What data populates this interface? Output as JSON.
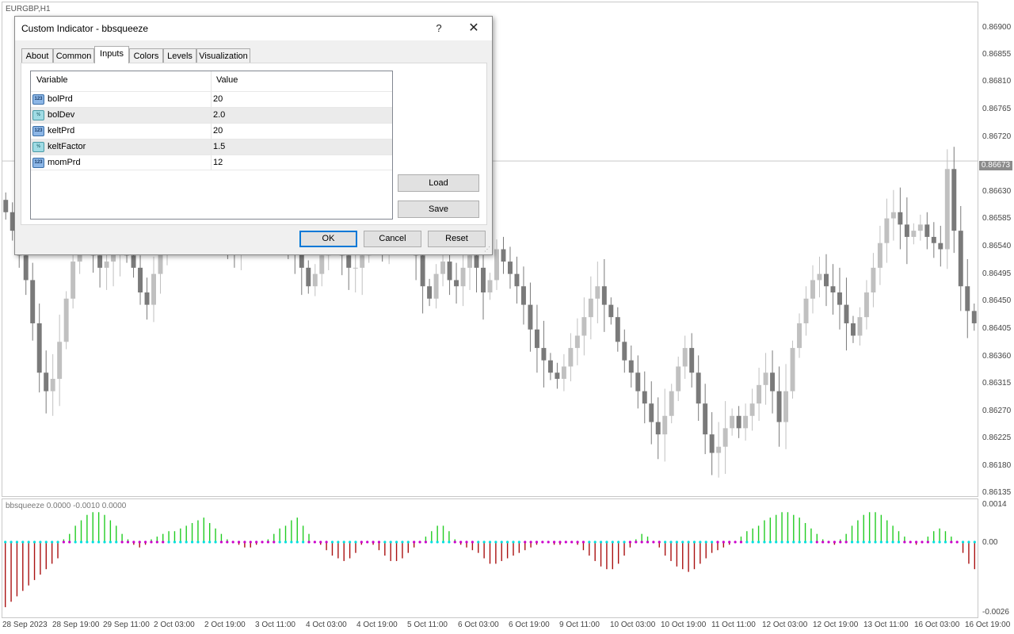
{
  "window": {
    "symbol_label": "EURGBP,H1"
  },
  "dialog": {
    "title": "Custom Indicator - bbsqueeze",
    "help_label": "?",
    "close_label": "✕",
    "tabs": [
      {
        "label": "About"
      },
      {
        "label": "Common"
      },
      {
        "label": "Inputs",
        "active": true
      },
      {
        "label": "Colors"
      },
      {
        "label": "Levels"
      },
      {
        "label": "Visualization"
      }
    ],
    "table": {
      "headers": {
        "variable": "Variable",
        "value": "Value"
      },
      "rows": [
        {
          "name": "bolPrd",
          "value": "20",
          "icon": "integer-type-icon",
          "icon_text": "123"
        },
        {
          "name": "bolDev",
          "value": "2.0",
          "icon": "double-type-icon",
          "icon_text": "½"
        },
        {
          "name": "keltPrd",
          "value": "20",
          "icon": "integer-type-icon",
          "icon_text": "123"
        },
        {
          "name": "keltFactor",
          "value": "1.5",
          "icon": "double-type-icon",
          "icon_text": "½"
        },
        {
          "name": "momPrd",
          "value": "12",
          "icon": "integer-type-icon",
          "icon_text": "123"
        }
      ]
    },
    "buttons": {
      "load": "Load",
      "save": "Save",
      "ok": "OK",
      "cancel": "Cancel",
      "reset": "Reset"
    }
  },
  "price_axis": {
    "labels": [
      "0.86900",
      "0.86855",
      "0.86810",
      "0.86765",
      "0.86720",
      "0.86630",
      "0.86585",
      "0.86540",
      "0.86495",
      "0.86450",
      "0.86405",
      "0.86360",
      "0.86315",
      "0.86270",
      "0.86225",
      "0.86180",
      "0.86135"
    ],
    "current_price": "0.86673"
  },
  "indicator": {
    "label": "bbsqueeze 0.0000 -0.0010 0.0000",
    "axis_labels": [
      "0.0014",
      "0.00",
      "-0.0026"
    ]
  },
  "time_axis": {
    "labels": [
      "28 Sep 2023",
      "28 Sep 19:00",
      "29 Sep 11:00",
      "2 Oct 03:00",
      "2 Oct 19:00",
      "3 Oct 11:00",
      "4 Oct 03:00",
      "4 Oct 19:00",
      "5 Oct 11:00",
      "6 Oct 03:00",
      "6 Oct 19:00",
      "9 Oct 11:00",
      "10 Oct 03:00",
      "10 Oct 19:00",
      "11 Oct 11:00",
      "12 Oct 03:00",
      "12 Oct 19:00",
      "13 Oct 11:00",
      "16 Oct 03:00",
      "16 Oct 19:00"
    ]
  },
  "colors": {
    "bull_candle": "#c0c0c0",
    "bear_candle": "#7a7a7a",
    "hist_up": "#22cc22",
    "hist_down": "#aa1111",
    "dot_squeeze": "#00e0e0",
    "dot_release": "#cc00cc"
  },
  "chart_data": {
    "type": "candlestick",
    "symbol": "EURGBP",
    "timeframe": "H1",
    "ylim": [
      0.8613,
      0.8693
    ],
    "close_series": [
      0.8659,
      0.8656,
      0.8652,
      0.8648,
      0.8641,
      0.8633,
      0.863,
      0.8632,
      0.8638,
      0.8645,
      0.8651,
      0.8656,
      0.8655,
      0.8652,
      0.865,
      0.8651,
      0.8653,
      0.8654,
      0.8652,
      0.865,
      0.8646,
      0.8644,
      0.8649,
      0.8654,
      0.8657,
      0.8659,
      0.8658,
      0.8657,
      0.8655,
      0.8656,
      0.8658,
      0.8657,
      0.8658,
      0.8655,
      0.8654,
      0.8655,
      0.8657,
      0.8658,
      0.8659,
      0.8658,
      0.8657,
      0.8656,
      0.8655,
      0.8653,
      0.865,
      0.8647,
      0.8649,
      0.8652,
      0.8655,
      0.8655,
      0.8652,
      0.865,
      0.865,
      0.8652,
      0.8655,
      0.8654,
      0.8653,
      0.8655,
      0.8656,
      0.8657,
      0.8656,
      0.8652,
      0.8647,
      0.8645,
      0.8649,
      0.8651,
      0.8648,
      0.8647,
      0.865,
      0.8652,
      0.865,
      0.8646,
      0.8648,
      0.8653,
      0.8651,
      0.8649,
      0.8647,
      0.8644,
      0.864,
      0.8637,
      0.8635,
      0.8633,
      0.8632,
      0.8634,
      0.8637,
      0.8639,
      0.8642,
      0.8645,
      0.8647,
      0.8644,
      0.8642,
      0.8638,
      0.8635,
      0.8633,
      0.863,
      0.8628,
      0.8625,
      0.8623,
      0.8626,
      0.863,
      0.8634,
      0.8637,
      0.8633,
      0.8628,
      0.8623,
      0.862,
      0.8621,
      0.8624,
      0.8626,
      0.8624,
      0.8626,
      0.8628,
      0.8631,
      0.8633,
      0.863,
      0.8625,
      0.863,
      0.8637,
      0.8641,
      0.8645,
      0.8648,
      0.8649,
      0.8647,
      0.8646,
      0.8644,
      0.8641,
      0.8639,
      0.8642,
      0.8646,
      0.865,
      0.8654,
      0.8658,
      0.8659,
      0.8657,
      0.8655,
      0.8656,
      0.8657,
      0.8655,
      0.8654,
      0.8653,
      0.8666,
      0.8656,
      0.8647,
      0.8643,
      0.8641
    ],
    "indicator_values": [
      -0.0024,
      -0.0022,
      -0.002,
      -0.0018,
      -0.0016,
      -0.0014,
      -0.0012,
      -0.001,
      -0.0008,
      -0.0006,
      0.0001,
      0.0003,
      0.0006,
      0.0008,
      0.001,
      0.0011,
      0.0011,
      0.001,
      0.0008,
      0.0006,
      0.0003,
      0.0001,
      -0.0001,
      -0.0002,
      -0.0001,
      0.0001,
      0.0002,
      0.0003,
      0.0004,
      0.0004,
      0.0005,
      0.0006,
      0.0007,
      0.0008,
      0.0009,
      0.0007,
      0.0005,
      0.0003,
      0.0001,
      0.0,
      -0.0001,
      -0.0002,
      -0.0002,
      -0.0001,
      0.0,
      0.0001,
      0.0003,
      0.0005,
      0.0006,
      0.0008,
      0.0009,
      0.0006,
      0.0003,
      0.0,
      -0.0001,
      -0.0003,
      -0.0005,
      -0.0006,
      -0.0007,
      -0.0006,
      -0.0004,
      -0.0001,
      0.0,
      -0.0001,
      -0.0003,
      -0.0005,
      -0.0007,
      -0.0007,
      -0.0006,
      -0.0004,
      -0.0002,
      0.0,
      0.0002,
      0.0004,
      0.0006,
      0.0006,
      0.0004,
      0.0001,
      -0.0001,
      -0.0002,
      -0.0003,
      -0.0004,
      -0.0006,
      -0.0008,
      -0.0008,
      -0.0007,
      -0.0006,
      -0.0005,
      -0.0004,
      -0.0003,
      -0.0002,
      -0.0001,
      0.0,
      0.0,
      -0.0001,
      -0.0001,
      0.0,
      0.0,
      -0.0001,
      -0.0003,
      -0.0005,
      -0.0007,
      -0.0009,
      -0.001,
      -0.001,
      -0.0008,
      -0.0005,
      -0.0002,
      0.0001,
      0.0003,
      0.0002,
      0.0,
      -0.0002,
      -0.0005,
      -0.0007,
      -0.0009,
      -0.001,
      -0.0011,
      -0.001,
      -0.0008,
      -0.0006,
      -0.0004,
      -0.0003,
      -0.0002,
      -0.0001,
      0.0,
      0.0002,
      0.0004,
      0.0005,
      0.0006,
      0.0008,
      0.0009,
      0.001,
      0.0011,
      0.0011,
      0.001,
      0.0009,
      0.0007,
      0.0005,
      0.0003,
      0.0001,
      0.0,
      -0.0001,
      0.0001,
      0.0003,
      0.0006,
      0.0008,
      0.001,
      0.0011,
      0.0011,
      0.001,
      0.0008,
      0.0006,
      0.0004,
      0.0002,
      0.0,
      -0.0001,
      0.0,
      0.0002,
      0.0004,
      0.0005,
      0.0004,
      0.0002,
      0.0,
      -0.0004,
      -0.0008,
      -0.001
    ]
  }
}
